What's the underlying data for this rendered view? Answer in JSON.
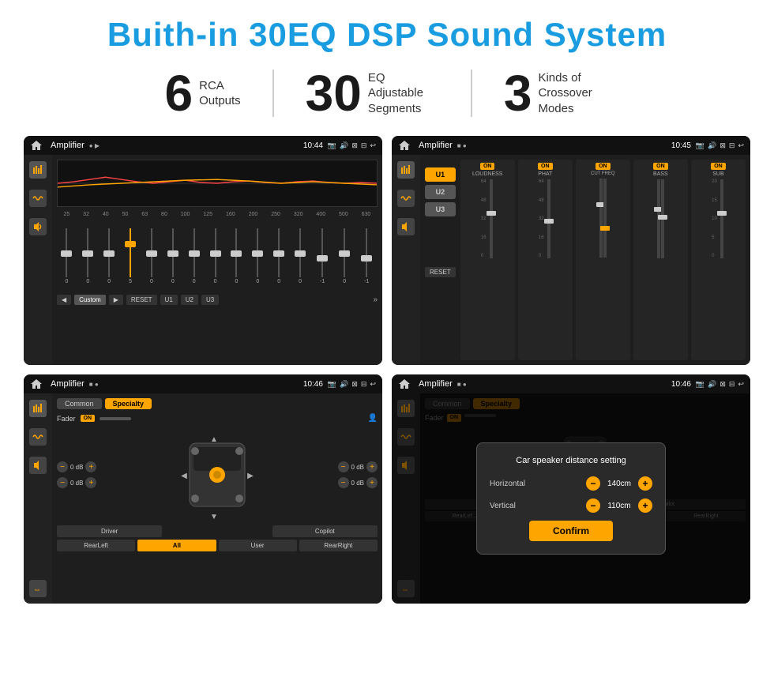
{
  "page": {
    "title": "Buith-in 30EQ DSP Sound System",
    "stats": [
      {
        "number": "6",
        "label": "RCA\nOutputs"
      },
      {
        "number": "30",
        "label": "EQ Adjustable\nSegments"
      },
      {
        "number": "3",
        "label": "Kinds of\nCrossover Modes"
      }
    ],
    "screens": [
      {
        "id": "screen1",
        "status_bar": {
          "app": "Amplifier",
          "time": "10:44",
          "icons": [
            "▶",
            "📷",
            "🔊",
            "⊠",
            "⊟",
            "↩"
          ]
        },
        "type": "eq",
        "eq_labels": [
          "25",
          "32",
          "40",
          "50",
          "63",
          "80",
          "100",
          "125",
          "160",
          "200",
          "250",
          "320",
          "400",
          "500",
          "630"
        ],
        "eq_values": [
          "0",
          "0",
          "0",
          "5",
          "0",
          "0",
          "0",
          "0",
          "0",
          "0",
          "0",
          "0",
          "-1",
          "0",
          "-1"
        ],
        "bottom_buttons": [
          "◀",
          "Custom",
          "▶",
          "RESET",
          "U1",
          "U2",
          "U3"
        ]
      },
      {
        "id": "screen2",
        "status_bar": {
          "app": "Amplifier",
          "time": "10:45"
        },
        "type": "amplifier",
        "presets": [
          "U1",
          "U2",
          "U3"
        ],
        "channels": [
          {
            "name": "LOUDNESS",
            "on": true
          },
          {
            "name": "PHAT",
            "on": true
          },
          {
            "name": "CUT FREQ",
            "on": true
          },
          {
            "name": "BASS",
            "on": true
          },
          {
            "name": "SUB",
            "on": true
          }
        ],
        "reset_label": "RESET"
      },
      {
        "id": "screen3",
        "status_bar": {
          "app": "Amplifier",
          "time": "10:46"
        },
        "type": "common",
        "tabs": [
          "Common",
          "Specialty"
        ],
        "fader_label": "Fader",
        "fader_on": "ON",
        "zone_labels": [
          "0 dB",
          "0 dB",
          "0 dB",
          "0 dB"
        ],
        "bottom_buttons": [
          "Driver",
          "",
          "Copilot",
          "RearLeft",
          "All",
          "User",
          "RearRight"
        ]
      },
      {
        "id": "screen4",
        "status_bar": {
          "app": "Amplifier",
          "time": "10:46"
        },
        "type": "dialog",
        "tabs": [
          "Common",
          "Specialty"
        ],
        "dialog": {
          "title": "Car speaker distance setting",
          "horizontal_label": "Horizontal",
          "horizontal_value": "140cm",
          "vertical_label": "Vertical",
          "vertical_value": "110cm",
          "confirm_label": "Confirm"
        }
      }
    ]
  }
}
